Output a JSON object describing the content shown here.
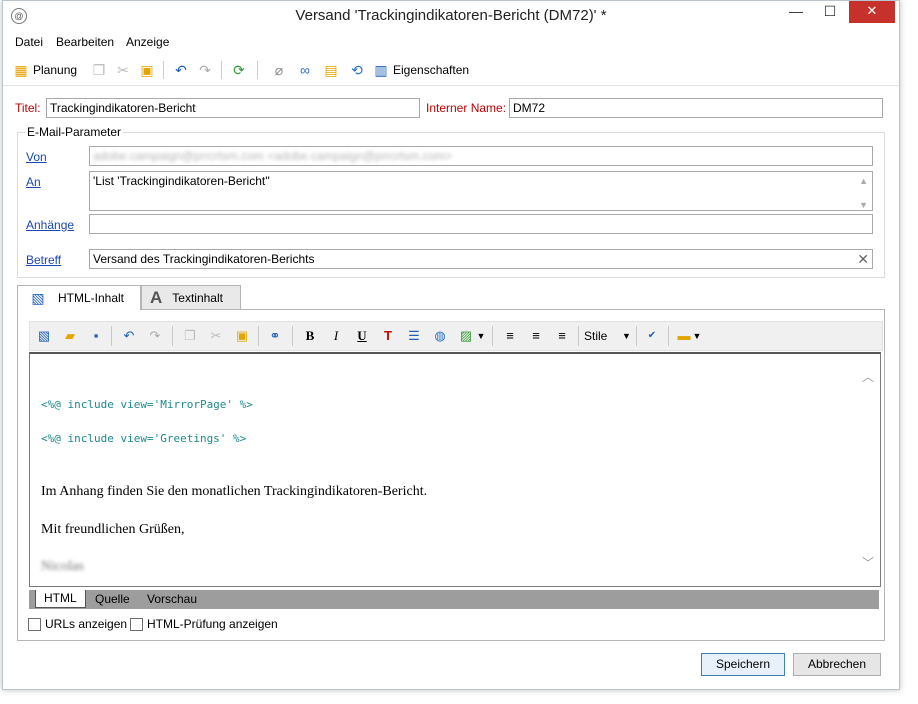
{
  "window": {
    "title": "Versand 'Trackingindikatoren-Bericht (DM72)' *",
    "controls": {
      "minimize": "—",
      "maximize": "☐",
      "close": "✕"
    }
  },
  "menu": [
    "Datei",
    "Bearbeiten",
    "Anzeige"
  ],
  "toolbar": {
    "planung_label": "Planung",
    "eigenschaften_label": "Eigenschaften",
    "icons": [
      "calendar-icon",
      "copy-icon",
      "cut-icon",
      "paste-icon",
      "undo-icon",
      "redo-icon",
      "refresh-icon",
      "attachment-icon",
      "link-icon",
      "gift-icon",
      "link-refresh-icon",
      "properties-icon"
    ]
  },
  "form": {
    "title_label": "Titel:",
    "title_value": "Trackingindikatoren-Bericht",
    "internal_name_label": "Interner Name:",
    "internal_name_value": "DM72",
    "email_group_label": "E-Mail-Parameter",
    "from_label": "Von",
    "from_value": "adobe.campaign@prrcrtsm.com <adobe.campaign@prrcrtsm.com>",
    "to_label": "An",
    "to_value": "'List 'Trackingindikatoren-Bericht''",
    "attachments_label": "Anhänge",
    "attachments_value": "",
    "subject_label": "Betreff",
    "subject_value": "Versand des Trackingindikatoren-Berichts"
  },
  "tabs": [
    {
      "label": "HTML-Inhalt",
      "active": true
    },
    {
      "label": "Textinhalt",
      "active": false
    }
  ],
  "editor_toolbar": {
    "style_label": "Stile",
    "bold": "B",
    "italic": "I",
    "underline": "U"
  },
  "editor": {
    "code_line_1": "<%@ include view='MirrorPage' %>",
    "code_line_2": "<%@ include view='Greetings' %>",
    "text_line_1": "Im Anhang finden Sie den monatlichen Trackingindikatoren-Bericht.",
    "text_line_2": "Mit freundlichen Grüßen,",
    "signature": "Nicolas"
  },
  "modes": [
    {
      "label": "HTML",
      "active": true
    },
    {
      "label": "Quelle",
      "active": false
    },
    {
      "label": "Vorschau",
      "active": false
    }
  ],
  "options": {
    "show_urls_label": "URLs anzeigen",
    "show_urls_checked": false,
    "html_check_label": "HTML-Prüfung anzeigen",
    "html_check_checked": false
  },
  "buttons": {
    "save": "Speichern",
    "cancel": "Abbrechen"
  },
  "colors": {
    "required_label": "#c00000",
    "link": "#1a46b4",
    "code": "#1c8a8a",
    "close_button": "#c7312b"
  }
}
